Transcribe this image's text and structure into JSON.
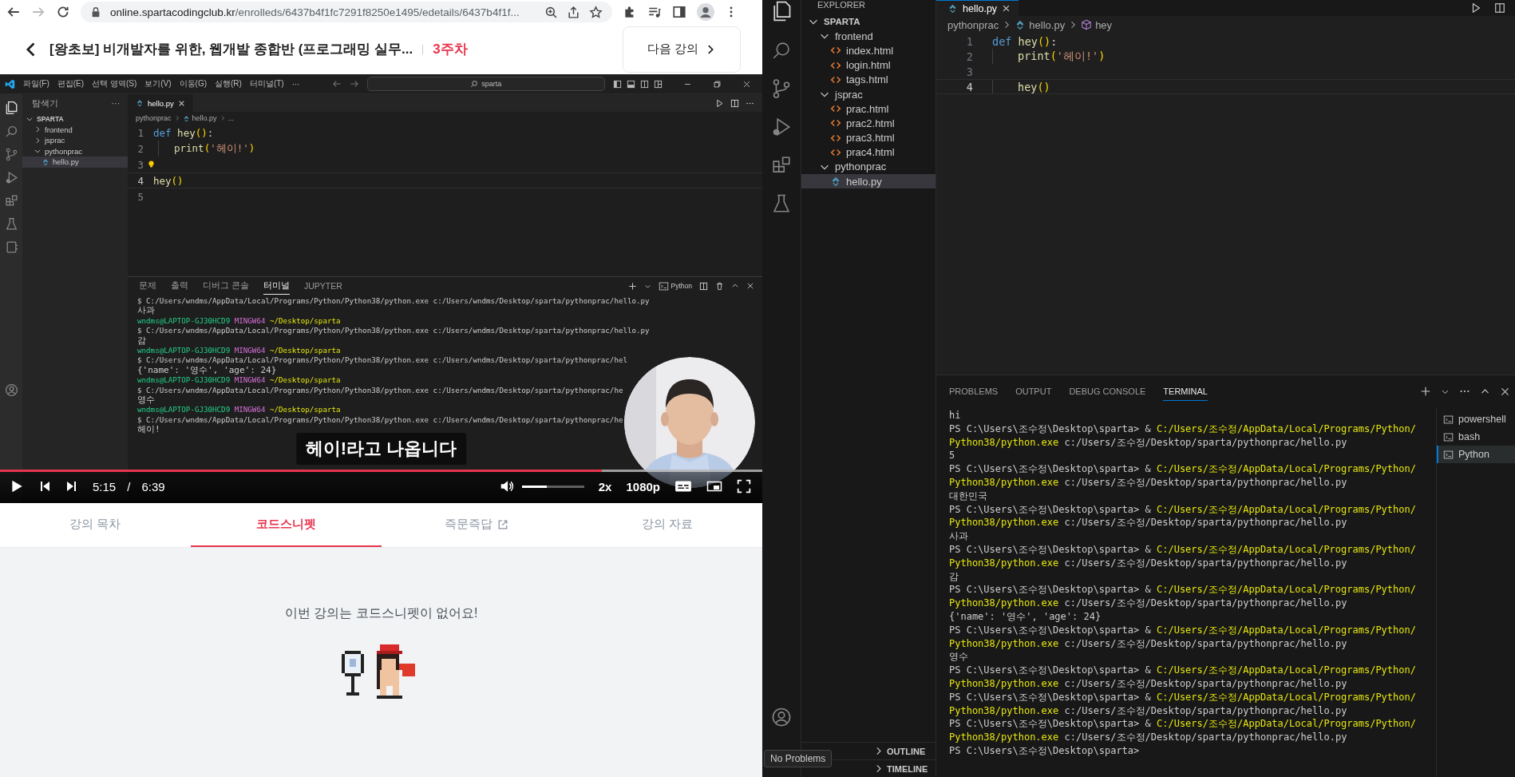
{
  "browser": {
    "back_enabled": true,
    "forward_enabled": false,
    "url_host": "online.spartacodingclub.kr",
    "url_path": "/enrolleds/6437b4f1fc7291f8250e1495/edetails/6437b4f1f..."
  },
  "course_header": {
    "title": "[왕초보] 비개발자를 위한, 웹개발 종합반 (프로그래밍 실무...",
    "week": "3주차",
    "next_button": "다음 강의"
  },
  "video": {
    "screen": {
      "menu": [
        "파일(F)",
        "편집(E)",
        "선택 영역(S)",
        "보기(V)",
        "이동(G)",
        "실행(R)",
        "터미널(T)",
        "⋯"
      ],
      "search": "sparta",
      "explorer": {
        "title": "탐색기",
        "more": "⋯",
        "tree": [
          {
            "name": "SPARTA",
            "kind": "workspace",
            "expanded": true,
            "selected": false,
            "children": [
              {
                "name": "frontend",
                "kind": "folder",
                "expanded": false,
                "selected": false
              },
              {
                "name": "jsprac",
                "kind": "folder",
                "expanded": false,
                "selected": false
              },
              {
                "name": "pythonprac",
                "kind": "folder",
                "expanded": true,
                "selected": false,
                "children": [
                  {
                    "name": "hello.py",
                    "kind": "python",
                    "selected": true
                  }
                ]
              }
            ]
          }
        ]
      },
      "tab": "hello.py",
      "breadcrumb": [
        {
          "label": "pythonprac",
          "kind": "folder"
        },
        {
          "label": "hello.py",
          "kind": "python"
        },
        {
          "label": "...",
          "kind": "more"
        }
      ],
      "code": [
        {
          "number": "1",
          "indented": false,
          "current": false,
          "tokens": [
            {
              "kind": "keyword",
              "text": "def"
            },
            {
              "kind": "function",
              "text": " hey"
            },
            {
              "kind": "paren",
              "text": "()"
            },
            {
              "kind": "plain",
              "text": ":"
            }
          ]
        },
        {
          "number": "2",
          "indented": true,
          "current": false,
          "tokens": [
            {
              "kind": "function",
              "text": "print"
            },
            {
              "kind": "paren",
              "text": "("
            },
            {
              "kind": "string",
              "text": "'헤이!'"
            },
            {
              "kind": "paren",
              "text": ")"
            }
          ]
        },
        {
          "number": "3",
          "current": false,
          "hint": true
        },
        {
          "number": "4",
          "indented": false,
          "current": true,
          "tokens": [
            {
              "kind": "function",
              "text": "hey"
            },
            {
              "kind": "paren",
              "text": "()"
            }
          ]
        },
        {
          "number": "5",
          "current": false
        }
      ],
      "panel_tabs": [
        {
          "label": "문제",
          "selected": false
        },
        {
          "label": "출력",
          "selected": false
        },
        {
          "label": "디버그 콘솔",
          "selected": false
        },
        {
          "label": "터미널",
          "selected": true
        },
        {
          "label": "JUPYTER",
          "selected": false
        }
      ],
      "terminal_profile": "Python",
      "terminal": [
        {
          "kind": "command",
          "text": "$ C:/Users/wndms/AppData/Local/Programs/Python/Python38/python.exe c:/Users/wndms/Desktop/sparta/pythonprac/hello.py"
        },
        {
          "kind": "output",
          "text": "사과"
        },
        {
          "kind": "prompt",
          "user": "wndms@LAPTOP-GJ30HCD9",
          "shell": "MINGW64",
          "path": "~/Desktop/sparta"
        },
        {
          "kind": "command",
          "text": "$ C:/Users/wndms/AppData/Local/Programs/Python/Python38/python.exe c:/Users/wndms/Desktop/sparta/pythonprac/hello.py"
        },
        {
          "kind": "output",
          "text": "감"
        },
        {
          "kind": "prompt",
          "user": "wndms@LAPTOP-GJ30HCD9",
          "shell": "MINGW64",
          "path": "~/Desktop/sparta"
        },
        {
          "kind": "command",
          "text": "$ C:/Users/wndms/AppData/Local/Programs/Python/Python38/python.exe c:/Users/wndms/Desktop/sparta/pythonprac/hel"
        },
        {
          "kind": "output",
          "text": "{'name': '영수', 'age': 24}"
        },
        {
          "kind": "prompt",
          "user": "wndms@LAPTOP-GJ30HCD9",
          "shell": "MINGW64",
          "path": "~/Desktop/sparta"
        },
        {
          "kind": "command",
          "text": "$ C:/Users/wndms/AppData/Local/Programs/Python/Python38/python.exe c:/Users/wndms/Desktop/sparta/pythonprac/he"
        },
        {
          "kind": "output",
          "text": "영수"
        },
        {
          "kind": "prompt",
          "user": "wndms@LAPTOP-GJ30HCD9",
          "shell": "MINGW64",
          "path": "~/Desktop/sparta"
        },
        {
          "kind": "command",
          "text": "$ C:/Users/wndms/AppData/Local/Programs/Python/Python38/python.exe c:/Users/wndms/Desktop/sparta/pythonprac/he"
        },
        {
          "kind": "output",
          "text": "헤이!"
        }
      ]
    },
    "subtitle": "헤이!라고 나옵니다",
    "controls": {
      "progress": {
        "level": 0.79
      },
      "current_time": "5:15",
      "separator": "/",
      "duration": "6:39",
      "volume": {
        "level": 0.4
      },
      "speed": "2x",
      "quality": "1080p"
    }
  },
  "lecture_tabs": [
    {
      "label": "강의 목차",
      "selected": false,
      "external": false
    },
    {
      "label": "코드스니펫",
      "selected": true,
      "external": false
    },
    {
      "label": "즉문즉답",
      "selected": false,
      "external": true
    },
    {
      "label": "강의 자료",
      "selected": false,
      "external": false
    }
  ],
  "snippet_panel": {
    "message": "이번 강의는 코드스니펫이 없어요!"
  },
  "editor_app": {
    "explorer": {
      "title": "EXPLORER",
      "tree": [
        {
          "name": "SPARTA",
          "kind": "workspace",
          "expanded": true,
          "selected": false,
          "children": [
            {
              "name": "frontend",
              "kind": "folder",
              "expanded": true,
              "selected": false,
              "children": [
                {
                  "name": "index.html",
                  "kind": "html",
                  "selected": false
                },
                {
                  "name": "login.html",
                  "kind": "html",
                  "selected": false
                },
                {
                  "name": "tags.html",
                  "kind": "html",
                  "selected": false
                }
              ]
            },
            {
              "name": "jsprac",
              "kind": "folder",
              "expanded": true,
              "selected": false,
              "children": [
                {
                  "name": "prac.html",
                  "kind": "html",
                  "selected": false
                },
                {
                  "name": "prac2.html",
                  "kind": "html",
                  "selected": false
                },
                {
                  "name": "prac3.html",
                  "kind": "html",
                  "selected": false
                },
                {
                  "name": "prac4.html",
                  "kind": "html",
                  "selected": false
                }
              ]
            },
            {
              "name": "pythonprac",
              "kind": "folder",
              "expanded": true,
              "selected": false,
              "children": [
                {
                  "name": "hello.py",
                  "kind": "python",
                  "selected": true
                }
              ]
            }
          ]
        }
      ],
      "sections": [
        {
          "label": "OUTLINE",
          "expanded": false
        },
        {
          "label": "TIMELINE",
          "expanded": false
        }
      ]
    },
    "tab": "hello.py",
    "breadcrumb": [
      {
        "label": "pythonprac",
        "kind": "folder"
      },
      {
        "label": "hello.py",
        "kind": "python"
      },
      {
        "label": "hey",
        "kind": "symbol"
      }
    ],
    "code": [
      {
        "number": "1",
        "indented": false,
        "current": false,
        "tokens": [
          {
            "kind": "keyword",
            "text": "def"
          },
          {
            "kind": "function",
            "text": " hey"
          },
          {
            "kind": "paren",
            "text": "()"
          },
          {
            "kind": "plain",
            "text": ":"
          }
        ]
      },
      {
        "number": "2",
        "indented": true,
        "current": false,
        "tokens": [
          {
            "kind": "function",
            "text": "print"
          },
          {
            "kind": "paren",
            "text": "("
          },
          {
            "kind": "string",
            "text": "'헤이!'"
          },
          {
            "kind": "paren",
            "text": ")"
          }
        ]
      },
      {
        "number": "3",
        "current": false
      },
      {
        "number": "4",
        "indented": true,
        "current": true,
        "tokens": [
          {
            "kind": "function",
            "text": "hey"
          },
          {
            "kind": "paren",
            "text": "()"
          }
        ]
      }
    ],
    "panel_tabs": [
      {
        "label": "PROBLEMS",
        "selected": false
      },
      {
        "label": "OUTPUT",
        "selected": false
      },
      {
        "label": "DEBUG CONSOLE",
        "selected": false
      },
      {
        "label": "TERMINAL",
        "selected": true
      }
    ],
    "terminal": [
      {
        "kind": "output",
        "text": "hi"
      },
      {
        "kind": "prompt",
        "prompt": "PS C:\\Users\\조수정\\Desktop\\sparta> &",
        "command": "C:/Users/조수정/AppData/Local/Programs/Python/"
      },
      {
        "kind": "continuation",
        "command": "Python38/python.exe",
        "args": "c:/Users/조수정/Desktop/sparta/pythonprac/hello.py"
      },
      {
        "kind": "output",
        "text": "5"
      },
      {
        "kind": "prompt",
        "prompt": "PS C:\\Users\\조수정\\Desktop\\sparta> &",
        "command": "C:/Users/조수정/AppData/Local/Programs/Python/"
      },
      {
        "kind": "continuation",
        "command": "Python38/python.exe",
        "args": "c:/Users/조수정/Desktop/sparta/pythonprac/hello.py"
      },
      {
        "kind": "output",
        "text": "대한민국"
      },
      {
        "kind": "prompt",
        "prompt": "PS C:\\Users\\조수정\\Desktop\\sparta> &",
        "command": "C:/Users/조수정/AppData/Local/Programs/Python/"
      },
      {
        "kind": "continuation",
        "command": "Python38/python.exe",
        "args": "c:/Users/조수정/Desktop/sparta/pythonprac/hello.py"
      },
      {
        "kind": "output",
        "text": "사과"
      },
      {
        "kind": "prompt",
        "prompt": "PS C:\\Users\\조수정\\Desktop\\sparta> &",
        "command": "C:/Users/조수정/AppData/Local/Programs/Python/"
      },
      {
        "kind": "continuation",
        "command": "Python38/python.exe",
        "args": "c:/Users/조수정/Desktop/sparta/pythonprac/hello.py"
      },
      {
        "kind": "output",
        "text": "감"
      },
      {
        "kind": "prompt",
        "prompt": "PS C:\\Users\\조수정\\Desktop\\sparta> &",
        "command": "C:/Users/조수정/AppData/Local/Programs/Python/"
      },
      {
        "kind": "continuation",
        "command": "Python38/python.exe",
        "args": "c:/Users/조수정/Desktop/sparta/pythonprac/hello.py"
      },
      {
        "kind": "output",
        "text": "{'name': '영수', 'age': 24}"
      },
      {
        "kind": "prompt",
        "prompt": "PS C:\\Users\\조수정\\Desktop\\sparta> &",
        "command": "C:/Users/조수정/AppData/Local/Programs/Python/"
      },
      {
        "kind": "continuation",
        "command": "Python38/python.exe",
        "args": "c:/Users/조수정/Desktop/sparta/pythonprac/hello.py"
      },
      {
        "kind": "output",
        "text": "영수"
      },
      {
        "kind": "prompt",
        "prompt": "PS C:\\Users\\조수정\\Desktop\\sparta> &",
        "command": "C:/Users/조수정/AppData/Local/Programs/Python/"
      },
      {
        "kind": "continuation",
        "command": "Python38/python.exe",
        "args": "c:/Users/조수정/Desktop/sparta/pythonprac/hello.py"
      },
      {
        "kind": "prompt",
        "prompt": "PS C:\\Users\\조수정\\Desktop\\sparta> &",
        "command": "C:/Users/조수정/AppData/Local/Programs/Python/"
      },
      {
        "kind": "continuation",
        "command": "Python38/python.exe",
        "args": "c:/Users/조수정/Desktop/sparta/pythonprac/hello.py"
      },
      {
        "kind": "prompt",
        "prompt": "PS C:\\Users\\조수정\\Desktop\\sparta> &",
        "command": "C:/Users/조수정/AppData/Local/Programs/Python/"
      },
      {
        "kind": "continuation",
        "command": "Python38/python.exe",
        "args": "c:/Users/조수정/Desktop/sparta/pythonprac/hello.py"
      },
      {
        "kind": "prompt",
        "prompt": "PS C:\\Users\\조수정\\Desktop\\sparta>"
      }
    ],
    "terminals": [
      {
        "label": "powershell",
        "selected": false
      },
      {
        "label": "bash",
        "selected": false
      },
      {
        "label": "Python",
        "selected": true
      }
    ],
    "tooltip": "No Problems"
  }
}
